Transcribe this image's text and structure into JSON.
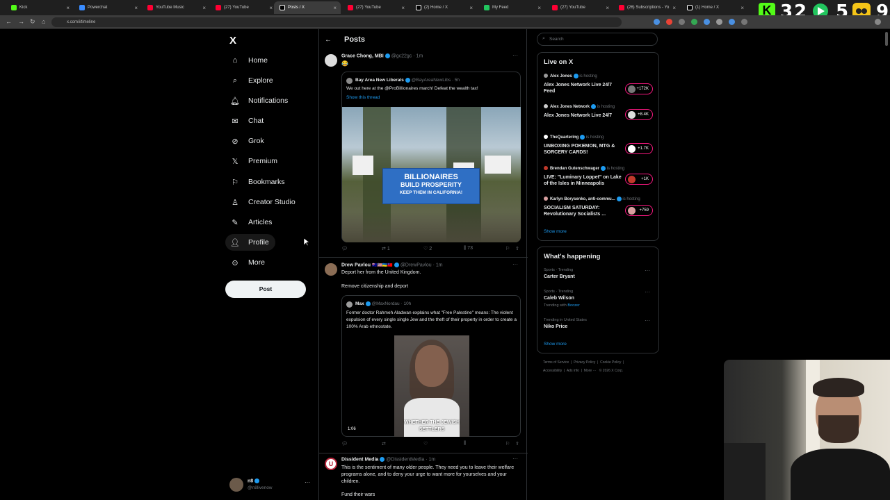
{
  "browser": {
    "tabs": [
      {
        "title": "Kick",
        "color": "#53fc18"
      },
      {
        "title": "Powerchat",
        "color": "#3a8cff"
      },
      {
        "title": "YouTube Music",
        "color": "#ff0033"
      },
      {
        "title": "(27) YouTube",
        "color": "#ff0033"
      },
      {
        "title": "Posts / X",
        "color": "#ffffff"
      },
      {
        "title": "(27) YouTube",
        "color": "#ff0033"
      },
      {
        "title": "(2) Home / X",
        "color": "#ffffff"
      },
      {
        "title": "My Feed",
        "color": "#22c55e"
      },
      {
        "title": "(27) YouTube",
        "color": "#ff0033"
      },
      {
        "title": "(26) Subscriptions - Yo",
        "color": "#ff0033"
      },
      {
        "title": "(1) Home / X",
        "color": "#ffffff"
      }
    ],
    "url": "x.com/i/timeline",
    "overlay_numbers": [
      "3",
      "2",
      "5",
      "9"
    ]
  },
  "nav": {
    "logo": "X",
    "items": [
      {
        "label": "Home",
        "icon": "home-icon"
      },
      {
        "label": "Explore",
        "icon": "search-icon"
      },
      {
        "label": "Notifications",
        "icon": "bell-icon"
      },
      {
        "label": "Chat",
        "icon": "mail-icon"
      },
      {
        "label": "Grok",
        "icon": "grok-icon"
      },
      {
        "label": "Premium",
        "icon": "x-logo-icon"
      },
      {
        "label": "Bookmarks",
        "icon": "bookmark-icon"
      },
      {
        "label": "Creator Studio",
        "icon": "creator-icon"
      },
      {
        "label": "Articles",
        "icon": "article-icon"
      },
      {
        "label": "Profile",
        "icon": "person-icon"
      },
      {
        "label": "More",
        "icon": "more-circle-icon"
      }
    ],
    "post_button": "Post",
    "account": {
      "name": "n8",
      "handle": "@n8livenow"
    }
  },
  "header": {
    "title": "Posts"
  },
  "posts": [
    {
      "name": "Grace Chong, MBI",
      "handle": "@gc22gc",
      "time": "· 1m",
      "text": "😂",
      "quote": {
        "name": "Bay Area New Liberals",
        "handle": "@BayAreaNewLibs",
        "time": "· 5h",
        "text": "We out here at the @ProBillionaires march! Defeat the wealth tax!",
        "show_thread": "Show this thread",
        "image_sign_line1": "BILLIONAIRES",
        "image_sign_line2": "BUILD PROSPERITY",
        "image_sign_line3": "KEEP THEM IN CALIFORNIA!"
      },
      "stats": {
        "replies": "",
        "reposts": "1",
        "likes": "2",
        "views": "73"
      }
    },
    {
      "name": "Drew Pavlou",
      "flags": "🇦🇺🇺🇸🇺🇦🇹🇼",
      "handle": "@DrewPavlou",
      "time": "· 1m",
      "text1": "Deport her from the United Kingdom.",
      "text2": "Remove citizenship and deport",
      "quote": {
        "name": "Max",
        "handle": "@MaxNordau",
        "time": "· 10h",
        "text": "Former doctor Rahmeh Aladwan explains what \"Free Palestine\" means: The violent expulsion of every single single Jew and the theft of their property in order to create a 100% Arab ethnostate.",
        "video_time": "1:06",
        "caption1": "WHETHER THE JEWISH",
        "caption2": "SETTLERS"
      }
    },
    {
      "name": "Dissident Media",
      "handle": "@DissidentMedia",
      "time": "· 1m",
      "text": "This is the sentiment of many older people. They need you to leave their welfare programs alone, and to deny your urge to want more for yourselves and your children.",
      "text2": "Fund their wars"
    }
  ],
  "search": {
    "placeholder": "Search"
  },
  "live": {
    "title": "Live on X",
    "hosting": "is hosting",
    "items": [
      {
        "host": "Alex Jones",
        "title": "Alex Jones Network Live 24/7 Feed",
        "count": "+172K"
      },
      {
        "host": "Alex Jones Network",
        "title": "Alex Jones Network Live 24/7",
        "count": "+8.4K"
      },
      {
        "host": "TheQuartering",
        "title": "UNBOXING POKEMON, MTG & SORCERY CARDS!",
        "count": "+1.7K"
      },
      {
        "host": "Brendan Gutenschwager",
        "title": "LIVE: \"Luminary Loppet\" on Lake of the Isles in Minneapolis",
        "count": "+1K"
      },
      {
        "host": "Karlyn Borysenko, anti-commu...",
        "title": "SOCIALISM SATURDAY: Revolutionary Socialists ...",
        "count": "+759"
      }
    ],
    "show_more": "Show more"
  },
  "trends": {
    "title": "What's happening",
    "items": [
      {
        "meta": "Sports · Trending",
        "name": "Carter Bryant",
        "sub": ""
      },
      {
        "meta": "Sports · Trending",
        "name": "Caleb Wilson",
        "sub_prefix": "Trending with ",
        "sub_link": "Boozer"
      },
      {
        "meta": "Trending in United States",
        "name": "Niko Price",
        "sub": ""
      }
    ],
    "show_more": "Show more"
  },
  "footer": {
    "line1": [
      "Terms of Service",
      "Privacy Policy",
      "Cookie Policy"
    ],
    "line2": [
      "Accessibility",
      "Ads info",
      "More ···",
      "© 2026 X Corp."
    ]
  }
}
